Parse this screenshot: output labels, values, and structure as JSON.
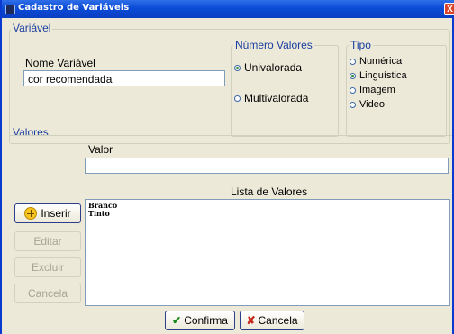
{
  "window": {
    "title": "Cadastro de Variáveis",
    "close_glyph": "X"
  },
  "variavel": {
    "legend": "Variável",
    "nome_label": "Nome Variável",
    "nome_value": "cor recomendada",
    "numero_valores": {
      "legend": "Número Valores",
      "options": [
        {
          "label": "Univalorada",
          "selected": true
        },
        {
          "label": "Multivalorada",
          "selected": false
        }
      ]
    },
    "tipo": {
      "legend": "Tipo",
      "options": [
        {
          "label": "Numérica",
          "selected": false
        },
        {
          "label": "Linguística",
          "selected": true
        },
        {
          "label": "Imagem",
          "selected": false
        },
        {
          "label": "Video",
          "selected": false
        }
      ]
    }
  },
  "valores": {
    "legend": "Valores",
    "valor_label": "Valor",
    "valor_value": "",
    "lista_label": "Lista de Valores",
    "lista_items": [
      "Branco",
      "Tinto"
    ],
    "buttons": {
      "inserir": "Inserir",
      "editar": "Editar",
      "excluir": "Excluir",
      "cancela": "Cancela"
    }
  },
  "footer": {
    "confirma": "Confirma",
    "cancela": "Cancela"
  },
  "icons": {
    "add": "plus-circle-icon",
    "confirm": "check-icon",
    "cancel": "x-icon",
    "close": "close-icon"
  }
}
